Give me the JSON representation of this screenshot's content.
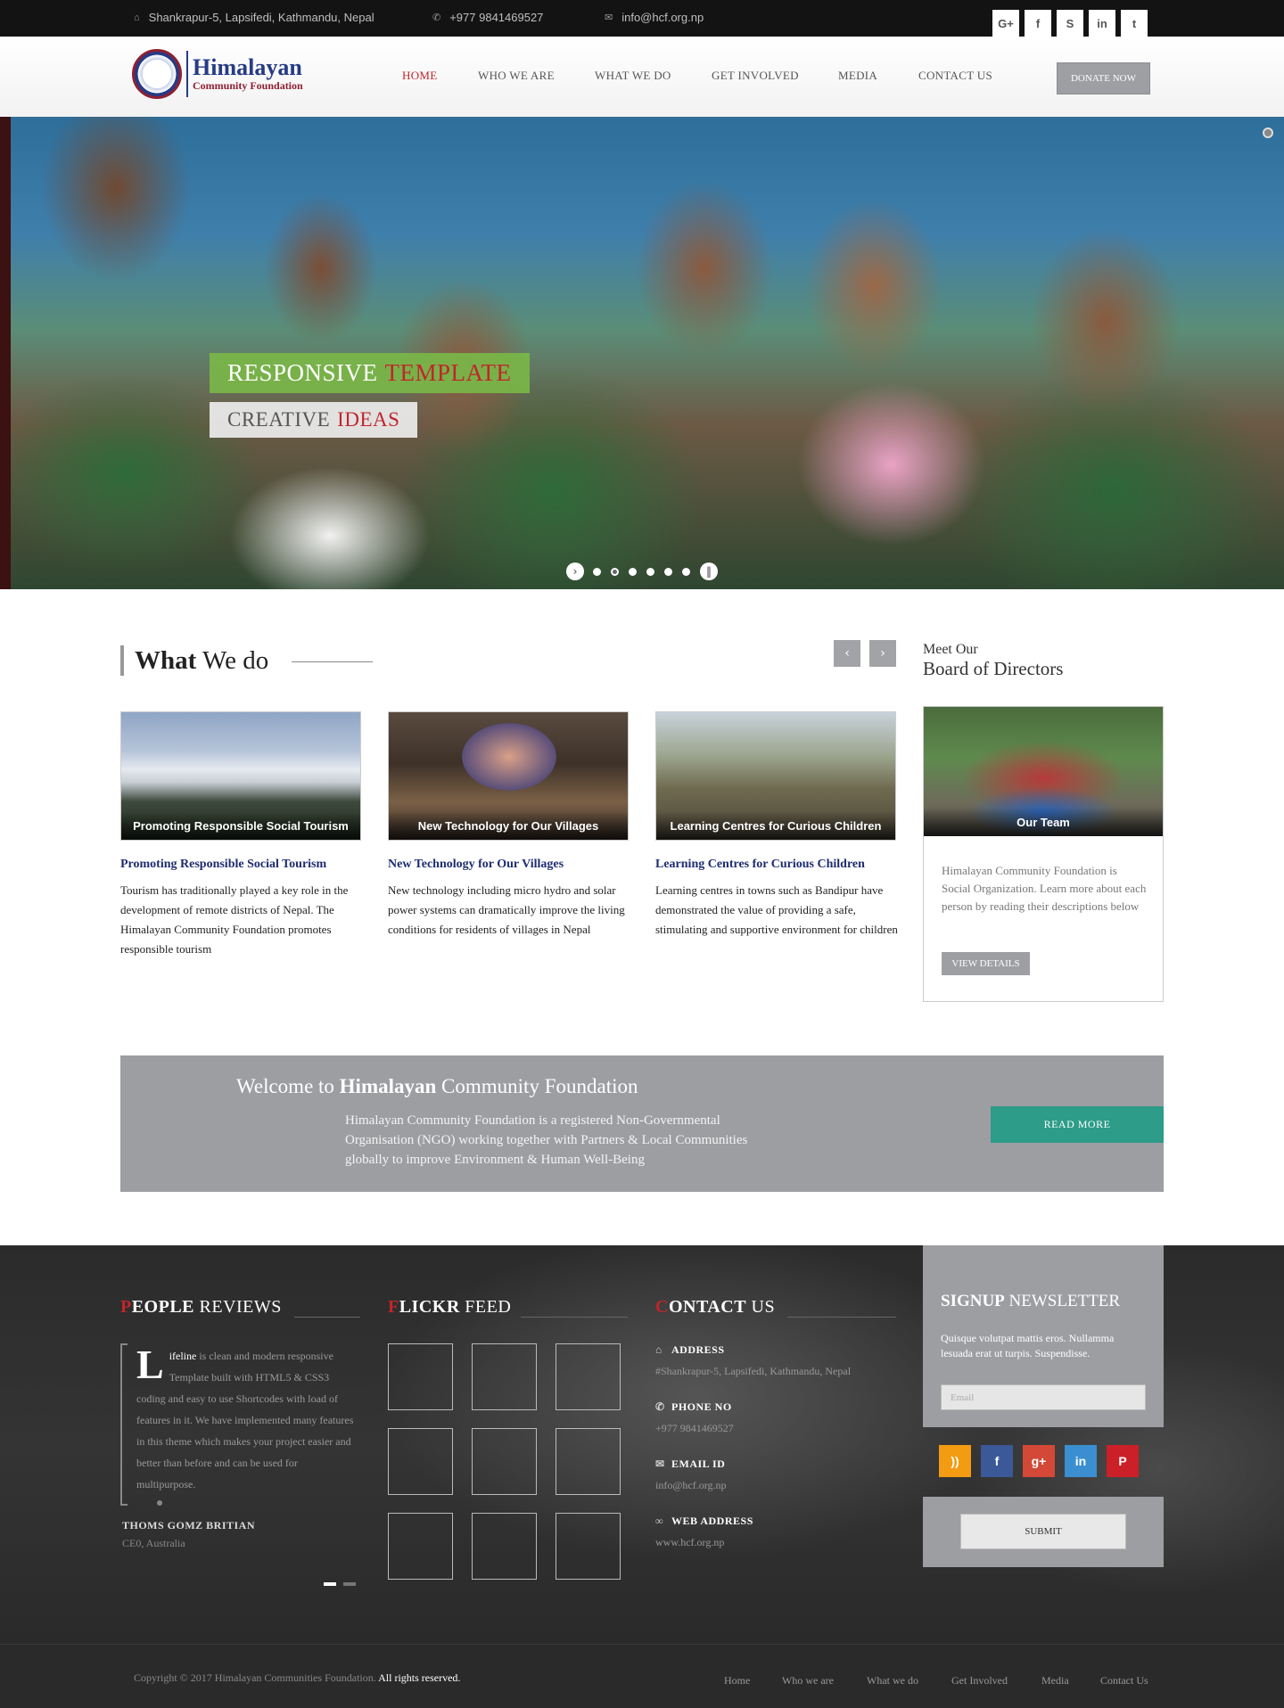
{
  "topbar": {
    "address": "Shankrapur-5, Lapsifedi, Kathmandu, Nepal",
    "phone": "+977 9841469527",
    "email": "info@hcf.org.np",
    "social": [
      "G+",
      "f",
      "S",
      "in",
      "t"
    ]
  },
  "header": {
    "logo_title": "Himalayan",
    "logo_subtitle": "Community Foundation",
    "nav": [
      "HOME",
      "WHO WE ARE",
      "WHAT WE DO",
      "GET INVOLVED",
      "MEDIA",
      "CONTACT US"
    ],
    "donate": "DONATE NOW"
  },
  "hero": {
    "caption1_a": "RESPONSIVE",
    "caption1_b": "TEMPLATE",
    "caption2_a": "CREATIVE",
    "caption2_b": "IDEAS",
    "slide_count": 6
  },
  "what_we_do": {
    "title_bold": "What",
    "title_rest": "We do",
    "cards": [
      {
        "caption": "Promoting Responsible Social Tourism",
        "title": "Promoting Responsible Social Tourism",
        "text": "Tourism has traditionally played a key role in the development of remote districts of Nepal. The Himalayan Community Foundation promotes responsible tourism"
      },
      {
        "caption": "New Technology for Our Villages",
        "title": "New Technology for Our Villages",
        "text": "New technology including micro hydro and solar power systems can dramatically improve the living conditions for residents of villages in Nepal"
      },
      {
        "caption": "Learning Centres for Curious Children",
        "title": "Learning Centres for Curious Children",
        "text": "Learning centres in towns such as Bandipur have demonstrated the value of providing a safe, stimulating and supportive environment for children"
      }
    ]
  },
  "board": {
    "subtitle": "Meet Our",
    "title": "Board of Directors",
    "image_caption": "Our Team",
    "text": "Himalayan Community Foundation is Social Organization. Learn more about each person by reading their descriptions below",
    "button": "VIEW DETAILS"
  },
  "welcome": {
    "pre": "Welcome to",
    "bold": "Himalayan",
    "post": "Community Foundation",
    "text": "Himalayan Community Foundation is a registered Non-Governmental Organisation (NGO) working together with Partners & Local Communities globally to improve Environment & Human Well-Being",
    "button": "READ MORE"
  },
  "footer": {
    "reviews": {
      "title_first": "P",
      "title_bold": "EOPLE",
      "title_rest": "REVIEWS",
      "dropcap": "L",
      "highlight": "ifeline",
      "text": " is clean and modern responsive Template built with HTML5 & CSS3 coding and easy to use Shortcodes with load of features in it. We have implemented many features in this theme which makes your project easier and better than before and can be used for multipurpose.",
      "name": "THOMS GOMZ BRITIAN",
      "role": "CE0, Australia"
    },
    "flickr": {
      "title_first": "F",
      "title_bold": "LICKR",
      "title_rest": "FEED"
    },
    "contact": {
      "title_first": "C",
      "title_bold": "ONTACT",
      "title_rest": "US",
      "address_label": "ADDRESS",
      "address": "#Shankrapur-5, Lapsifedi, Kathmandu, Nepal",
      "phone_label": "PHONE NO",
      "phone": "+977 9841469527",
      "email_label": "EMAIL ID",
      "email": "info@hcf.org.np",
      "web_label": "WEB ADDRESS",
      "web": "www.hcf.org.np"
    },
    "newsletter": {
      "title_bold": "SIGNUP",
      "title_rest": "NEWSLETTER",
      "text": "Quisque volutpat mattis eros. Nullamma lesuada erat ut turpis. Suspendisse.",
      "placeholder": "Email",
      "submit": "SUBMIT"
    },
    "social_colors": [
      "#f39c12",
      "#3b5998",
      "#d34836",
      "#3b8fd0",
      "#cb2027"
    ]
  },
  "bottom": {
    "copyright": "Copyright © 2017 Himalayan Communities Foundation.",
    "rights": "All rights reserved.",
    "links": [
      "Home",
      "Who we are",
      "What we do",
      "Get Involved",
      "Media",
      "Contact Us"
    ]
  }
}
